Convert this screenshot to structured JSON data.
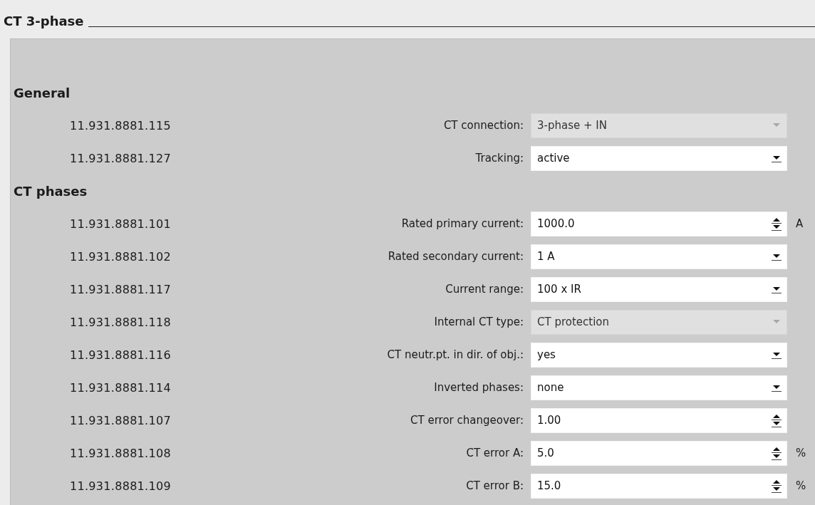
{
  "title": "CT 3-phase",
  "sections": [
    {
      "heading": "General",
      "rows": [
        {
          "id": "11.931.8881.115",
          "label": "CT connection:",
          "kind": "dropdown",
          "value": "3-phase + IN",
          "disabled": true
        },
        {
          "id": "11.931.8881.127",
          "label": "Tracking:",
          "kind": "dropdown",
          "value": "active",
          "disabled": false
        }
      ]
    },
    {
      "heading": "CT phases",
      "rows": [
        {
          "id": "11.931.8881.101",
          "label": "Rated primary current:",
          "kind": "spinner",
          "value": "1000.0",
          "disabled": false,
          "unit": "A"
        },
        {
          "id": "11.931.8881.102",
          "label": "Rated secondary current:",
          "kind": "dropdown",
          "value": "1 A",
          "disabled": false
        },
        {
          "id": "11.931.8881.117",
          "label": "Current range:",
          "kind": "dropdown",
          "value": "100 x IR",
          "disabled": false
        },
        {
          "id": "11.931.8881.118",
          "label": "Internal CT type:",
          "kind": "dropdown",
          "value": "CT protection",
          "disabled": true
        },
        {
          "id": "11.931.8881.116",
          "label": "CT neutr.pt. in dir. of obj.:",
          "kind": "dropdown",
          "value": "yes",
          "disabled": false
        },
        {
          "id": "11.931.8881.114",
          "label": "Inverted phases:",
          "kind": "dropdown",
          "value": "none",
          "disabled": false
        },
        {
          "id": "11.931.8881.107",
          "label": "CT error changeover:",
          "kind": "spinner",
          "value": "1.00",
          "disabled": false
        },
        {
          "id": "11.931.8881.108",
          "label": "CT error A:",
          "kind": "spinner",
          "value": "5.0",
          "disabled": false,
          "unit": "%"
        },
        {
          "id": "11.931.8881.109",
          "label": "CT error B:",
          "kind": "spinner",
          "value": "15.0",
          "disabled": false,
          "unit": "%"
        }
      ]
    }
  ]
}
